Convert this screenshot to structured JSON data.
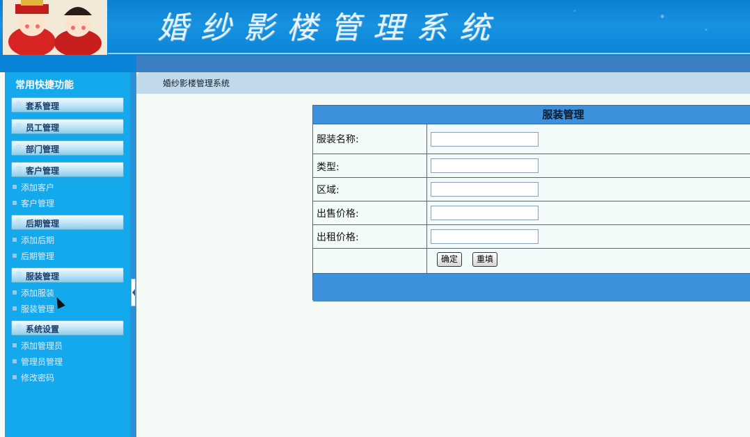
{
  "header": {
    "title": "婚纱影楼管理系统"
  },
  "sidebar": {
    "heading": "常用快捷功能",
    "categories": [
      {
        "label": "套系管理",
        "items": []
      },
      {
        "label": "员工管理",
        "items": []
      },
      {
        "label": "部门管理",
        "items": []
      },
      {
        "label": "客户管理",
        "items": [
          {
            "label": "添加客户"
          },
          {
            "label": "客户管理"
          }
        ]
      },
      {
        "label": "后期管理",
        "items": [
          {
            "label": "添加后期"
          },
          {
            "label": "后期管理"
          }
        ]
      },
      {
        "label": "服装管理",
        "items": [
          {
            "label": "添加服装"
          },
          {
            "label": "服装管理"
          }
        ]
      },
      {
        "label": "系统设置",
        "items": [
          {
            "label": "添加管理员"
          },
          {
            "label": "管理员管理"
          },
          {
            "label": "修改密码"
          }
        ]
      }
    ]
  },
  "breadcrumb": "婚纱影楼管理系统",
  "form": {
    "caption": "服装管理",
    "fields": [
      {
        "label": "服装名称:",
        "value": ""
      },
      {
        "label": "类型:",
        "value": ""
      },
      {
        "label": "区域:",
        "value": ""
      },
      {
        "label": "出售价格:",
        "value": ""
      },
      {
        "label": "出租价格:",
        "value": ""
      }
    ],
    "submit_label": "确定",
    "reset_label": "重填"
  },
  "colors": {
    "header_blue": "#0c7fd0",
    "sidebar_blue": "#14a8ec",
    "table_border": "#2a6fb5",
    "table_caption": "#3d90dc"
  }
}
